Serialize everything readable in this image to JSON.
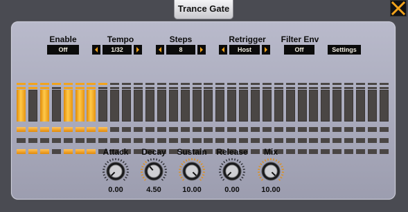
{
  "window": {
    "title": "Trance Gate"
  },
  "controls": {
    "enable": {
      "label": "Enable",
      "value": "Off"
    },
    "tempo": {
      "label": "Tempo",
      "value": "1/32"
    },
    "steps": {
      "label": "Steps",
      "value": "8"
    },
    "retrigger": {
      "label": "Retrigger",
      "value": "Host"
    },
    "filter_env": {
      "label": "Filter Env",
      "value": "Off"
    },
    "settings_label": "Settings"
  },
  "colors": {
    "accent": "#f2a31c",
    "step_off": "#4a4644",
    "panel": "#aeafc0",
    "value_box": "#0b0b0b"
  },
  "step_count": 32,
  "steps": [
    {
      "top": true,
      "mid": true,
      "bar": true,
      "sq1": true,
      "sq3": true
    },
    {
      "top": true,
      "mid": true,
      "bar": false,
      "sq1": true,
      "sq3": true
    },
    {
      "top": true,
      "mid": true,
      "bar": true,
      "sq1": true,
      "sq3": true
    },
    {
      "top": true,
      "mid": false,
      "bar": false,
      "sq1": true,
      "sq3": false
    },
    {
      "top": true,
      "mid": true,
      "bar": true,
      "sq1": true,
      "sq3": true
    },
    {
      "top": true,
      "mid": true,
      "bar": true,
      "sq1": true,
      "sq3": true
    },
    {
      "top": true,
      "mid": true,
      "bar": true,
      "sq1": true,
      "sq3": true
    },
    {
      "top": true,
      "mid": false,
      "bar": false,
      "sq1": true,
      "sq3": false
    }
  ],
  "knobs": [
    {
      "label": "Attack",
      "value": "0.00",
      "level": 0.0,
      "ring": false
    },
    {
      "label": "Decay",
      "value": "4.50",
      "level": 0.35,
      "ring": true
    },
    {
      "label": "Sustain",
      "value": "10.00",
      "level": 1.0,
      "ring": true
    },
    {
      "label": "Release",
      "value": "0.00",
      "level": 0.0,
      "ring": false
    },
    {
      "label": "Mix",
      "value": "10.00",
      "level": 1.0,
      "ring": true
    }
  ]
}
